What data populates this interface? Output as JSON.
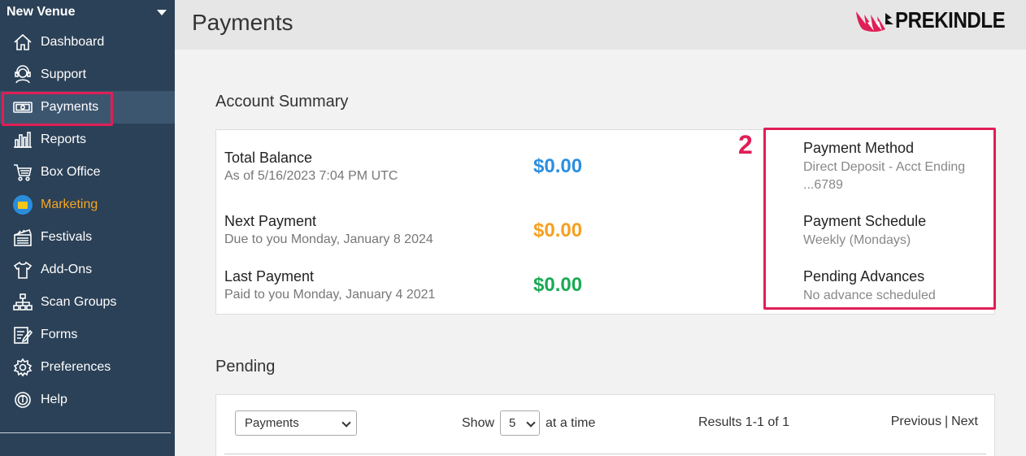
{
  "sidebar": {
    "venue": "New Venue",
    "items": [
      {
        "label": "Dashboard",
        "icon": "house-icon"
      },
      {
        "label": "Support",
        "icon": "headset-icon"
      },
      {
        "label": "Payments",
        "icon": "cash-icon"
      },
      {
        "label": "Reports",
        "icon": "bar-chart-icon"
      },
      {
        "label": "Box Office",
        "icon": "cart-icon"
      },
      {
        "label": "Marketing",
        "icon": "mail-icon"
      },
      {
        "label": "Festivals",
        "icon": "clapperboard-icon"
      },
      {
        "label": "Add-Ons",
        "icon": "shirt-icon"
      },
      {
        "label": "Scan Groups",
        "icon": "org-chart-icon"
      },
      {
        "label": "Forms",
        "icon": "form-edit-icon"
      },
      {
        "label": "Preferences",
        "icon": "gear-icon"
      },
      {
        "label": "Help",
        "icon": "help-icon"
      }
    ]
  },
  "header": {
    "title": "Payments",
    "logo_text": "PREKINDLE"
  },
  "account_summary": {
    "title": "Account Summary",
    "total_balance": {
      "label": "Total Balance",
      "sub": "As of 5/16/2023 7:04 PM UTC",
      "amount": "$0.00"
    },
    "next_payment": {
      "label": "Next Payment",
      "sub": "Due to you Monday, January 8 2024",
      "amount": "$0.00"
    },
    "last_payment": {
      "label": "Last Payment",
      "sub": "Paid to you Monday, January 4 2021",
      "amount": "$0.00"
    },
    "step_number": "2",
    "payment_method": {
      "label": "Payment Method",
      "value": "Direct Deposit - Acct Ending ...6789"
    },
    "payment_schedule": {
      "label": "Payment Schedule",
      "value": "Weekly (Mondays)"
    },
    "pending_advances": {
      "label": "Pending Advances",
      "value": "No advance scheduled"
    }
  },
  "pending": {
    "title": "Pending",
    "filter_selected": "Payments",
    "show_label": "Show",
    "page_size": "5",
    "at_a_time": "at a time",
    "results": "Results 1-1 of 1",
    "previous": "Previous",
    "separator": "|",
    "next": "Next"
  },
  "colors": {
    "sidebar": "#2b4157",
    "highlight": "#e01f56",
    "total_amount": "#2b8fe0",
    "next_amount": "#f5a020",
    "last_amount": "#1aaa55",
    "marketing": "#f5a623"
  }
}
